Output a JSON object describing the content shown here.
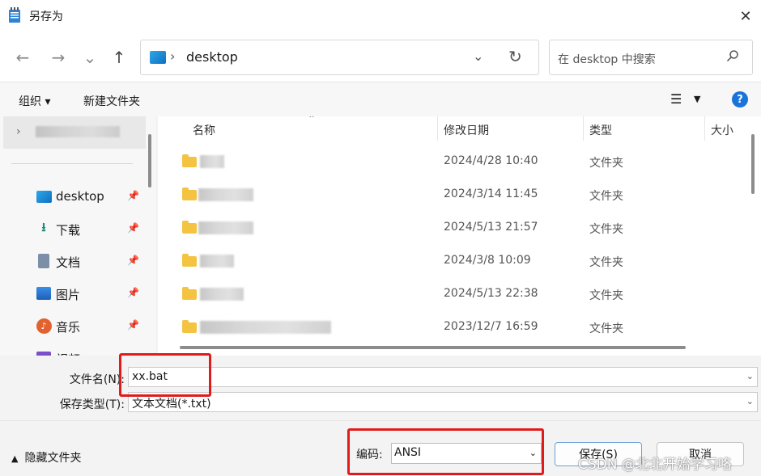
{
  "window": {
    "title": "另存为",
    "close_glyph": "✕"
  },
  "nav": {
    "back": "←",
    "forward": "→",
    "history": "⌄",
    "up": "↑"
  },
  "address": {
    "path": "desktop",
    "sep": "›",
    "dropdown": "⌄",
    "refresh": "↻"
  },
  "search": {
    "placeholder": "在 desktop 中搜索",
    "icon": "search-icon"
  },
  "toolbar": {
    "organize": "组织 ▾",
    "new_folder": "新建文件夹",
    "view_glyph": "☰",
    "view_dd": "▼",
    "help": "?"
  },
  "sidebar": {
    "items": [
      {
        "label": "desktop",
        "icon": "desktop-icon",
        "pinned": true
      },
      {
        "label": "下载",
        "icon": "download-icon",
        "pinned": true
      },
      {
        "label": "文档",
        "icon": "document-icon",
        "pinned": true
      },
      {
        "label": "图片",
        "icon": "picture-icon",
        "pinned": true
      },
      {
        "label": "音乐",
        "icon": "music-icon",
        "pinned": true
      },
      {
        "label": "视频",
        "icon": "video-icon",
        "pinned": false
      }
    ]
  },
  "columns": {
    "name": "名称",
    "modified": "修改日期",
    "type": "类型",
    "size": "大小"
  },
  "files": [
    {
      "date": "2024/4/28 10:40",
      "type": "文件夹"
    },
    {
      "date": "2024/3/14 11:45",
      "type": "文件夹"
    },
    {
      "date": "2024/5/13 21:57",
      "type": "文件夹"
    },
    {
      "date": "2024/3/8 10:09",
      "type": "文件夹"
    },
    {
      "date": "2024/5/13 22:38",
      "type": "文件夹"
    },
    {
      "date": "2023/12/7 16:59",
      "type": "文件夹"
    }
  ],
  "form": {
    "filename_label": "文件名(N):",
    "filename_value": "xx.bat",
    "filetype_label": "保存类型(T):",
    "filetype_value": "文本文档(*.txt)"
  },
  "bottom": {
    "hide_folders": "隐藏文件夹",
    "encoding_label": "编码:",
    "encoding_value": "ANSI",
    "save": "保存(S)",
    "cancel": "取消"
  },
  "watermark": "CSDN @北北开始学习咯",
  "colors": {
    "accent": "#1a73d9",
    "highlight": "#e11b1b",
    "folder": "#f4c342"
  }
}
